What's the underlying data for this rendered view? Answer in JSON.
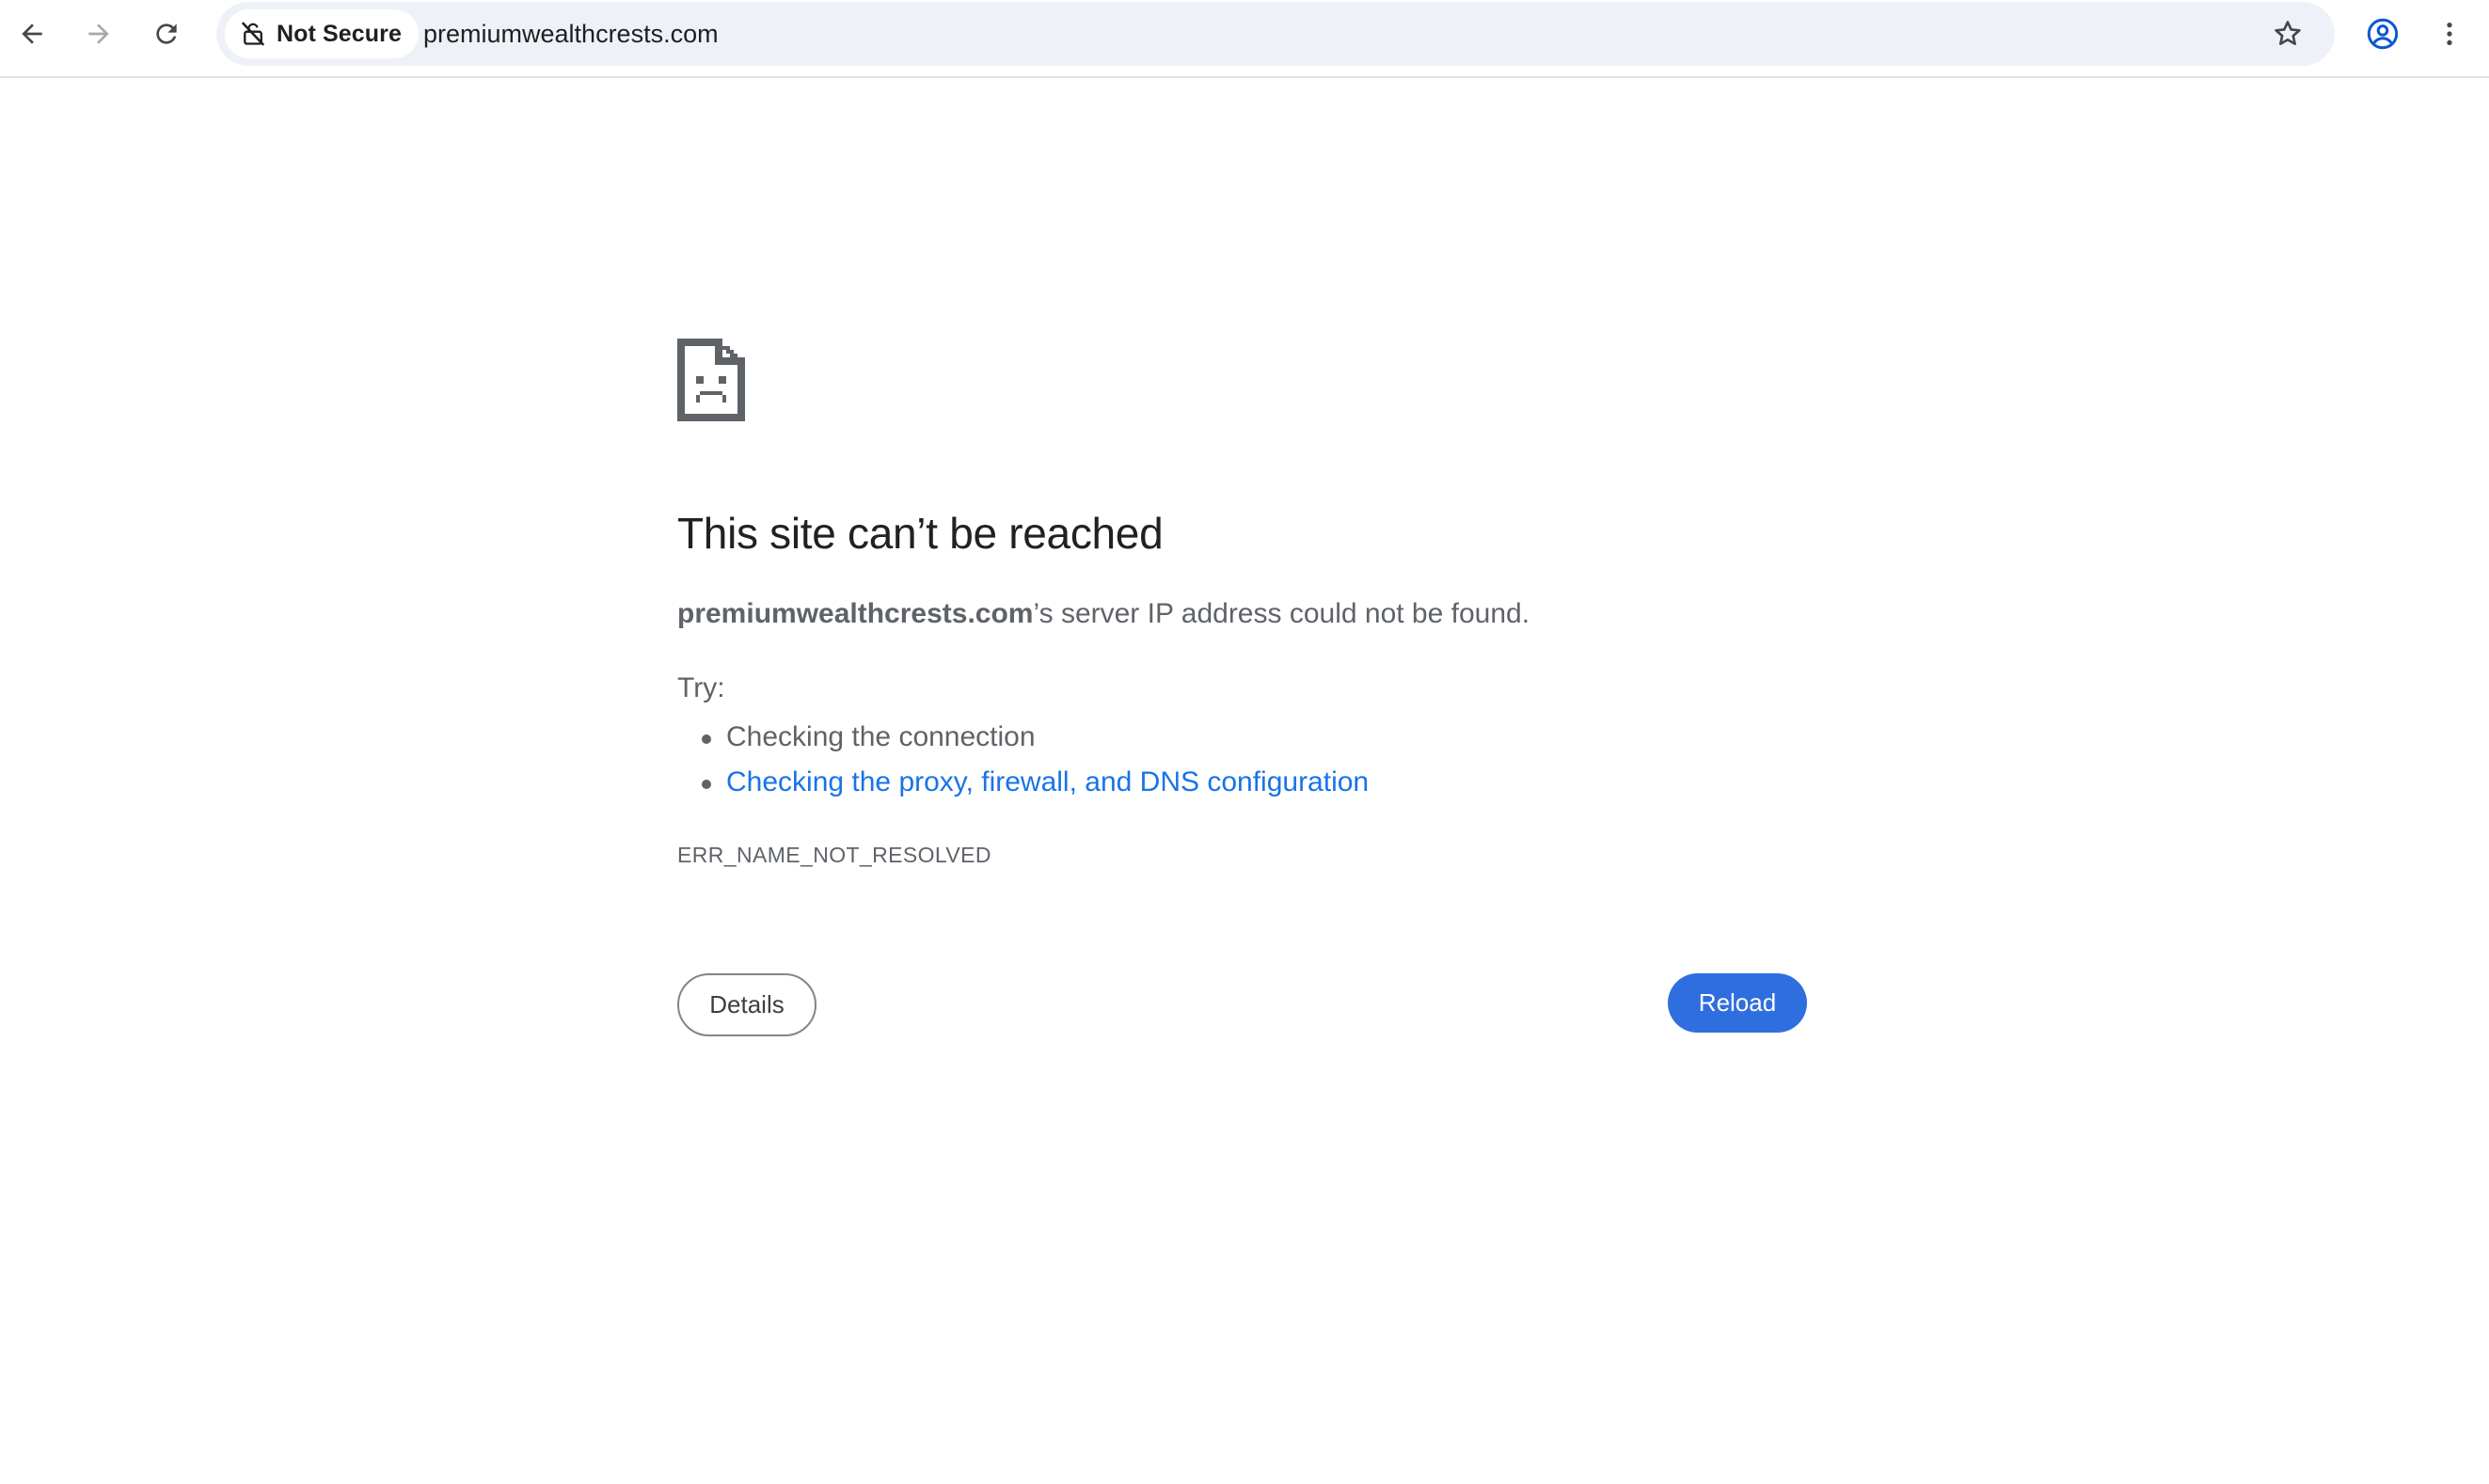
{
  "toolbar": {
    "back_label": "Back",
    "forward_label": "Forward",
    "reload_label": "Reload page",
    "security_label": "Not Secure",
    "url": "premiumwealthcrests.com",
    "bookmark_label": "Bookmark this tab",
    "profile_label": "Profile",
    "menu_label": "Customize and control"
  },
  "error": {
    "headline": "This site can’t be reached",
    "domain": "premiumwealthcrests.com",
    "summary_rest": "’s server IP address could not be found.",
    "try_label": "Try:",
    "suggestions": [
      {
        "text": "Checking the connection",
        "link": false
      },
      {
        "text": "Checking the proxy, firewall, and DNS configuration",
        "link": true
      }
    ],
    "code": "ERR_NAME_NOT_RESOLVED",
    "details_button": "Details",
    "reload_button": "Reload"
  },
  "icons": {
    "back": "arrow-left-icon",
    "forward": "arrow-right-icon",
    "reload": "refresh-icon",
    "security": "broken-lock-icon",
    "bookmark": "star-outline-icon",
    "profile": "account-circle-icon",
    "menu": "kebab-menu-icon",
    "error": "sad-page-icon"
  },
  "colors": {
    "link": "#1a73e8",
    "primary_button": "#2f6ede",
    "text": "#5f6368",
    "headline": "#202124",
    "omnibox": "#eef2f8"
  }
}
